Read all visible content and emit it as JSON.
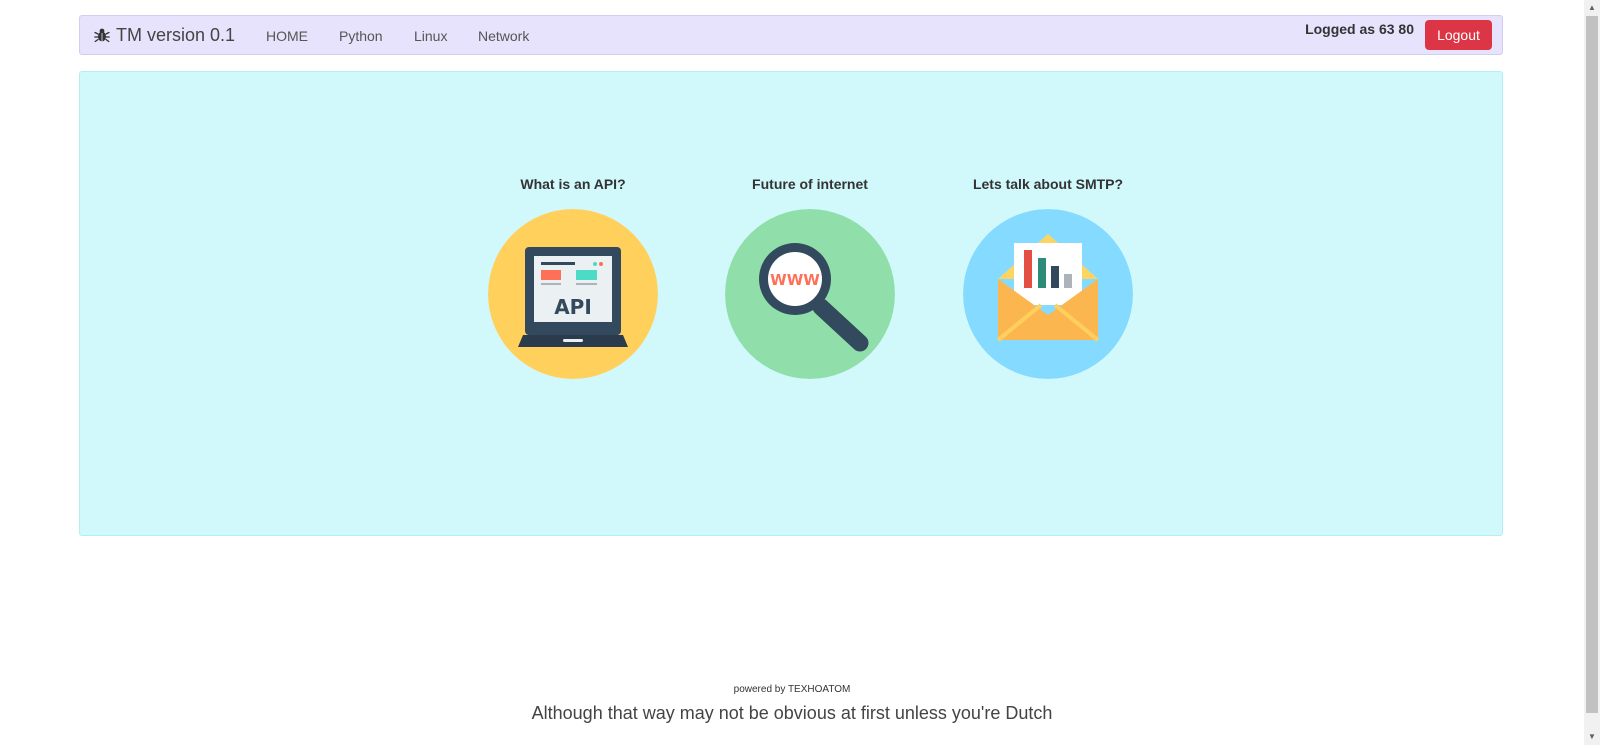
{
  "navbar": {
    "brand_icon": "bug-icon",
    "brand_label": "TM version 0.1",
    "links": [
      {
        "label": "HOME"
      },
      {
        "label": "Python"
      },
      {
        "label": "Linux"
      },
      {
        "label": "Network"
      }
    ],
    "logged_text": "Logged as 63 80",
    "logout_label": "Logout",
    "background_color": "#e8e3fc",
    "logout_color": "#dc3545"
  },
  "hero": {
    "background_color": "#d1f9fb",
    "cards": [
      {
        "title": "What is an API?",
        "icon": "laptop-api-icon",
        "circle_color": "#ffd15c",
        "image_text": "API"
      },
      {
        "title": "Future of internet",
        "icon": "magnifier-www-icon",
        "circle_color": "#90dfaa",
        "image_text": "WWW"
      },
      {
        "title": "Lets talk about SMTP?",
        "icon": "envelope-chart-icon",
        "circle_color": "#84dbff"
      }
    ]
  },
  "footer": {
    "powered": "powered by TEXHOATOM",
    "quote": "Although that way may not be obvious at first unless you're Dutch"
  }
}
